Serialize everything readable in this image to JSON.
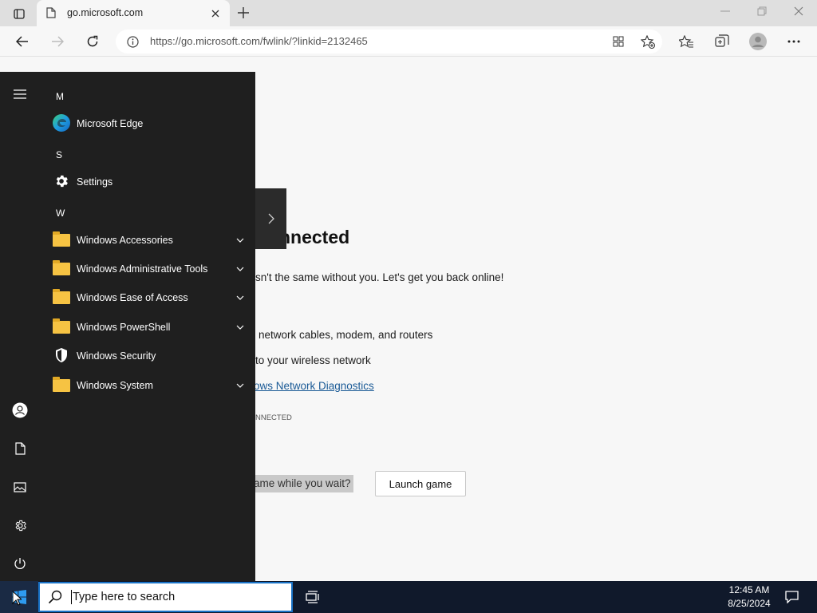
{
  "browser": {
    "tab_title": "go.microsoft.com",
    "url": "https://go.microsoft.com/fwlink/?linkid=2132465"
  },
  "page": {
    "heading": "nnected",
    "subtitle": "isn't the same without you. Let's get you back online!",
    "tip1": "network cables, modem, and routers",
    "tip2": "to your wireless network",
    "diagnostics_link": "ows Network Diagnostics",
    "status_code": "NNECTED",
    "game_prompt": "ame while you wait?",
    "launch_button": "Launch game"
  },
  "start_menu": {
    "letters": {
      "m": "M",
      "s": "S",
      "w": "W"
    },
    "items": [
      {
        "label": "Microsoft Edge",
        "icon": "edge-icon"
      },
      {
        "label": "Settings",
        "icon": "gear-icon"
      },
      {
        "label": "Windows Accessories",
        "icon": "folder-icon",
        "expandable": true
      },
      {
        "label": "Windows Administrative Tools",
        "icon": "folder-icon",
        "expandable": true
      },
      {
        "label": "Windows Ease of Access",
        "icon": "folder-icon",
        "expandable": true
      },
      {
        "label": "Windows PowerShell",
        "icon": "folder-icon",
        "expandable": true
      },
      {
        "label": "Windows Security",
        "icon": "shield-icon"
      },
      {
        "label": "Windows System",
        "icon": "folder-icon",
        "expandable": true
      }
    ]
  },
  "taskbar": {
    "search_placeholder": "Type here to search",
    "time": "12:45 AM",
    "date": "8/25/2024"
  },
  "colors": {
    "accent": "#1a73c7",
    "start_menu_bg": "#1f1f1f",
    "taskbar_bg": "#10192b",
    "folder": "#f6c343",
    "link": "#1a5a96"
  }
}
